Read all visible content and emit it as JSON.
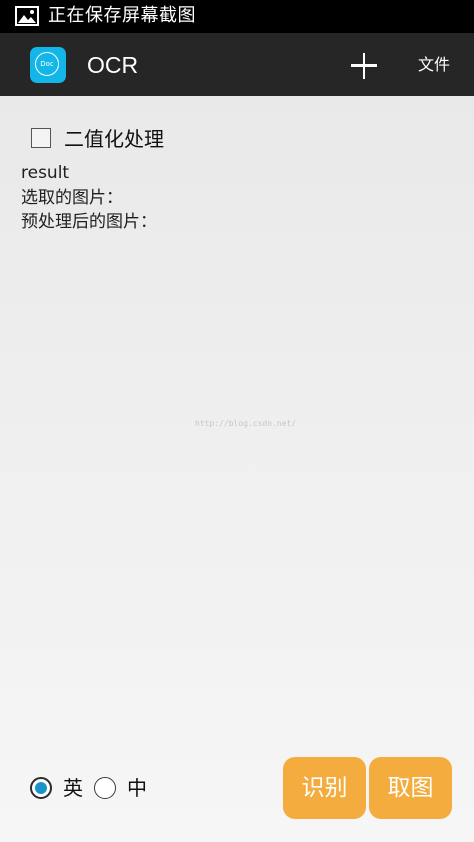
{
  "status_bar": {
    "icon": "image-icon",
    "text": "正在保存屏幕截图"
  },
  "action_bar": {
    "app_icon_text": "Doc",
    "title": "OCR",
    "add_icon": "plus-icon",
    "menu_file": "文件"
  },
  "options": {
    "binarize_label": "二值化处理",
    "binarize_checked": false
  },
  "content": {
    "result_label": "result",
    "selected_image_label": "选取的图片：",
    "processed_image_label": "预处理后的图片："
  },
  "watermark": "http://blog.csdn.net/",
  "language": {
    "english_label": "英",
    "chinese_label": "中",
    "selected": "英"
  },
  "buttons": {
    "recognize": "识别",
    "pick_image": "取图"
  },
  "colors": {
    "accent_button": "#f3ac3d",
    "app_icon": "#13b6e8",
    "radio_selected": "#1a93c9",
    "action_bar": "#262626"
  }
}
